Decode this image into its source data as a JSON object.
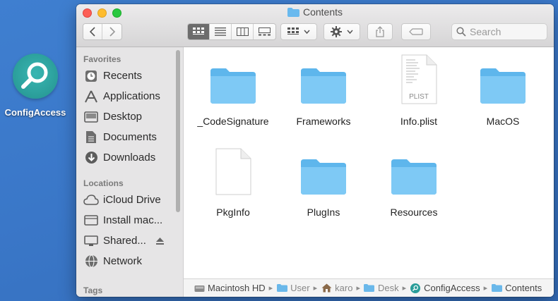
{
  "desktop": {
    "app_label": "ConfigAccess"
  },
  "window": {
    "title": "Contents",
    "search_placeholder": "Search"
  },
  "sidebar": {
    "favorites_header": "Favorites",
    "favorites": [
      {
        "label": "Recents",
        "icon": "clock-icon"
      },
      {
        "label": "Applications",
        "icon": "applications-icon"
      },
      {
        "label": "Desktop",
        "icon": "desktop-icon"
      },
      {
        "label": "Documents",
        "icon": "document-icon"
      },
      {
        "label": "Downloads",
        "icon": "download-icon"
      }
    ],
    "locations_header": "Locations",
    "locations": [
      {
        "label": "iCloud Drive",
        "icon": "cloud-icon"
      },
      {
        "label": "Install mac...",
        "icon": "disk-icon"
      },
      {
        "label": "Shared...",
        "icon": "display-icon"
      },
      {
        "label": "Network",
        "icon": "globe-icon"
      }
    ],
    "tags_header": "Tags"
  },
  "files": [
    {
      "name": "_CodeSignature",
      "kind": "folder"
    },
    {
      "name": "Frameworks",
      "kind": "folder"
    },
    {
      "name": "Info.plist",
      "kind": "plist",
      "badge": "PLIST"
    },
    {
      "name": "MacOS",
      "kind": "folder"
    },
    {
      "name": "PkgInfo",
      "kind": "file"
    },
    {
      "name": "PlugIns",
      "kind": "folder"
    },
    {
      "name": "Resources",
      "kind": "folder"
    }
  ],
  "pathbar": [
    {
      "label": "Macintosh HD",
      "icon": "hard-drive-icon"
    },
    {
      "label": "User",
      "icon": "folder-icon"
    },
    {
      "label": "karo",
      "icon": "home-icon"
    },
    {
      "label": "Desk",
      "icon": "folder-icon"
    },
    {
      "label": "ConfigAccess",
      "icon": "app-icon"
    },
    {
      "label": "Contents",
      "icon": "folder-icon"
    }
  ],
  "colors": {
    "folder": "#6ac0f2",
    "accent": "#2a9d99"
  }
}
